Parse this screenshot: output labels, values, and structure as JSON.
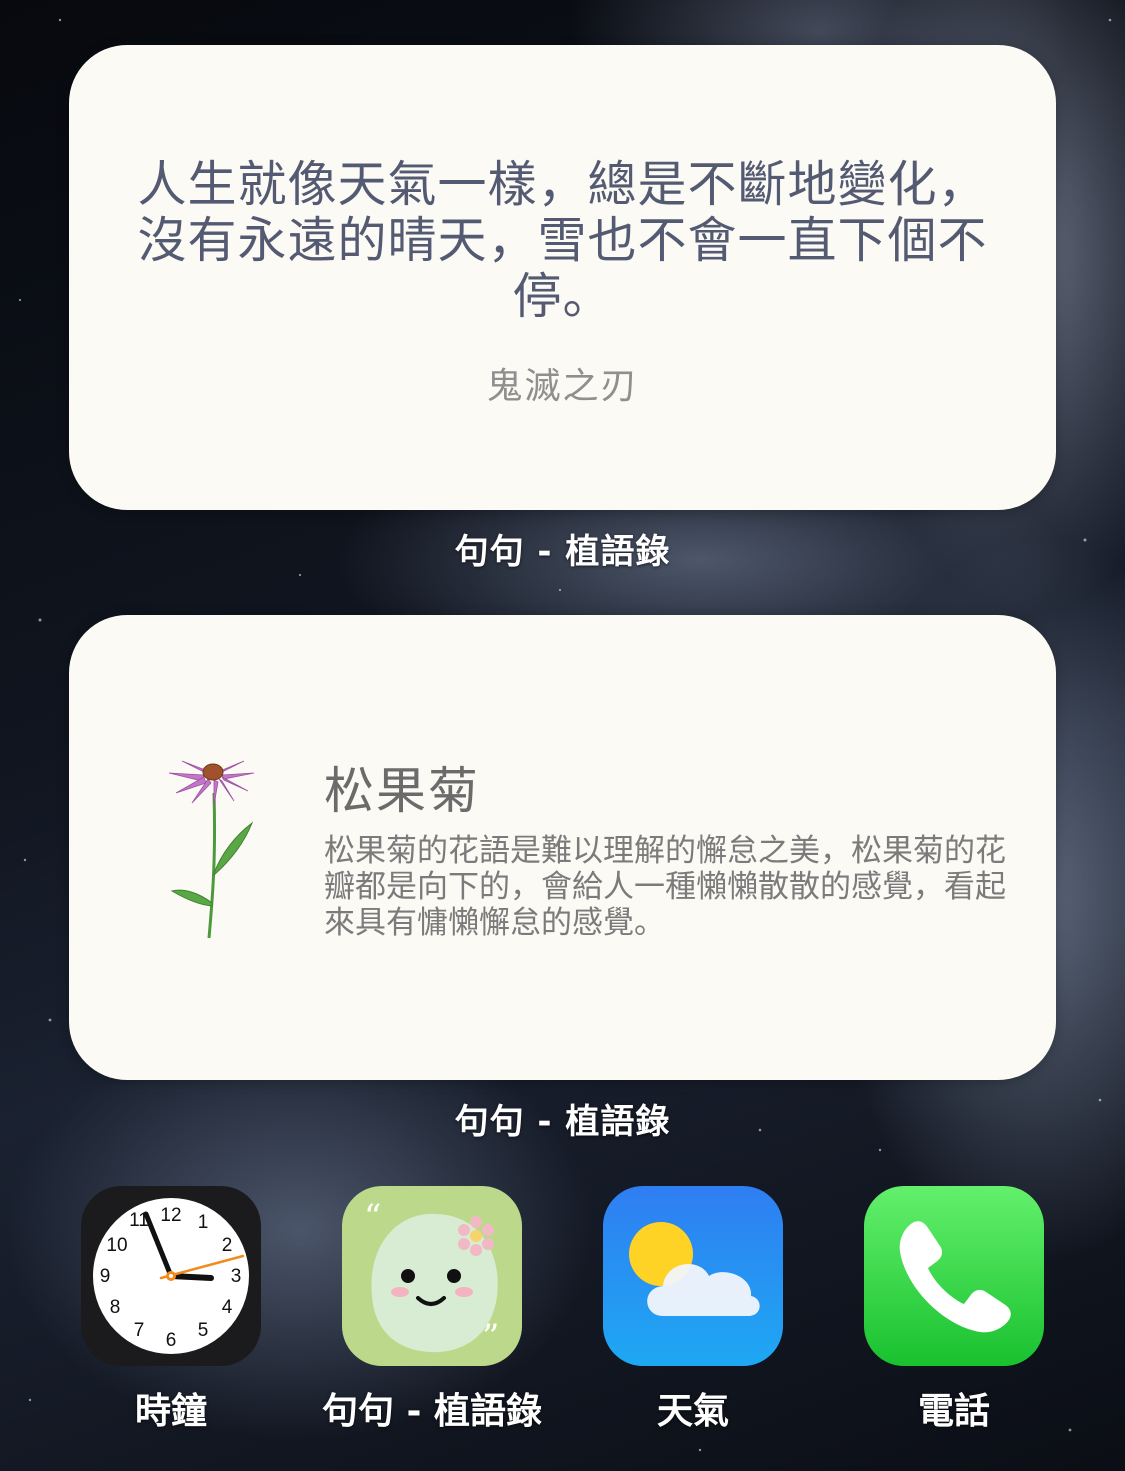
{
  "quote_widget": {
    "quote": "人生就像天氣一樣，總是不斷地變化，沒有永遠的晴天，雪也不會一直下個不停。",
    "source": "鬼滅之刃"
  },
  "captions": {
    "widget1": "句句 - 植語錄",
    "widget2": "句句 - 植語錄"
  },
  "flower_widget": {
    "name": "松果菊",
    "description": "松果菊的花語是難以理解的懈怠之美，松果菊的花瓣都是向下的，會給人一種懶懶散散的感覺，看起來具有慵懶懈怠的感覺。",
    "petal_color": "#c277c6",
    "stem_color": "#4d9a3c"
  },
  "dock": {
    "apps": [
      {
        "label": "時鐘",
        "icon": "clock-icon"
      },
      {
        "label": "句句 - 植語錄",
        "icon": "smiley-leaf-icon"
      },
      {
        "label": "天氣",
        "icon": "weather-icon"
      },
      {
        "label": "電話",
        "icon": "phone-icon"
      }
    ],
    "clock_numbers": [
      "12",
      "1",
      "2",
      "3",
      "4",
      "5",
      "6",
      "7",
      "8",
      "9",
      "10",
      "11"
    ]
  },
  "colors": {
    "widget_bg": "#fbfaf5",
    "quote_text": "#555a73",
    "quotes_app_bg": "#bcd98b",
    "phone_green": "#19c12f",
    "weather_blue": "#2f7ef2"
  }
}
